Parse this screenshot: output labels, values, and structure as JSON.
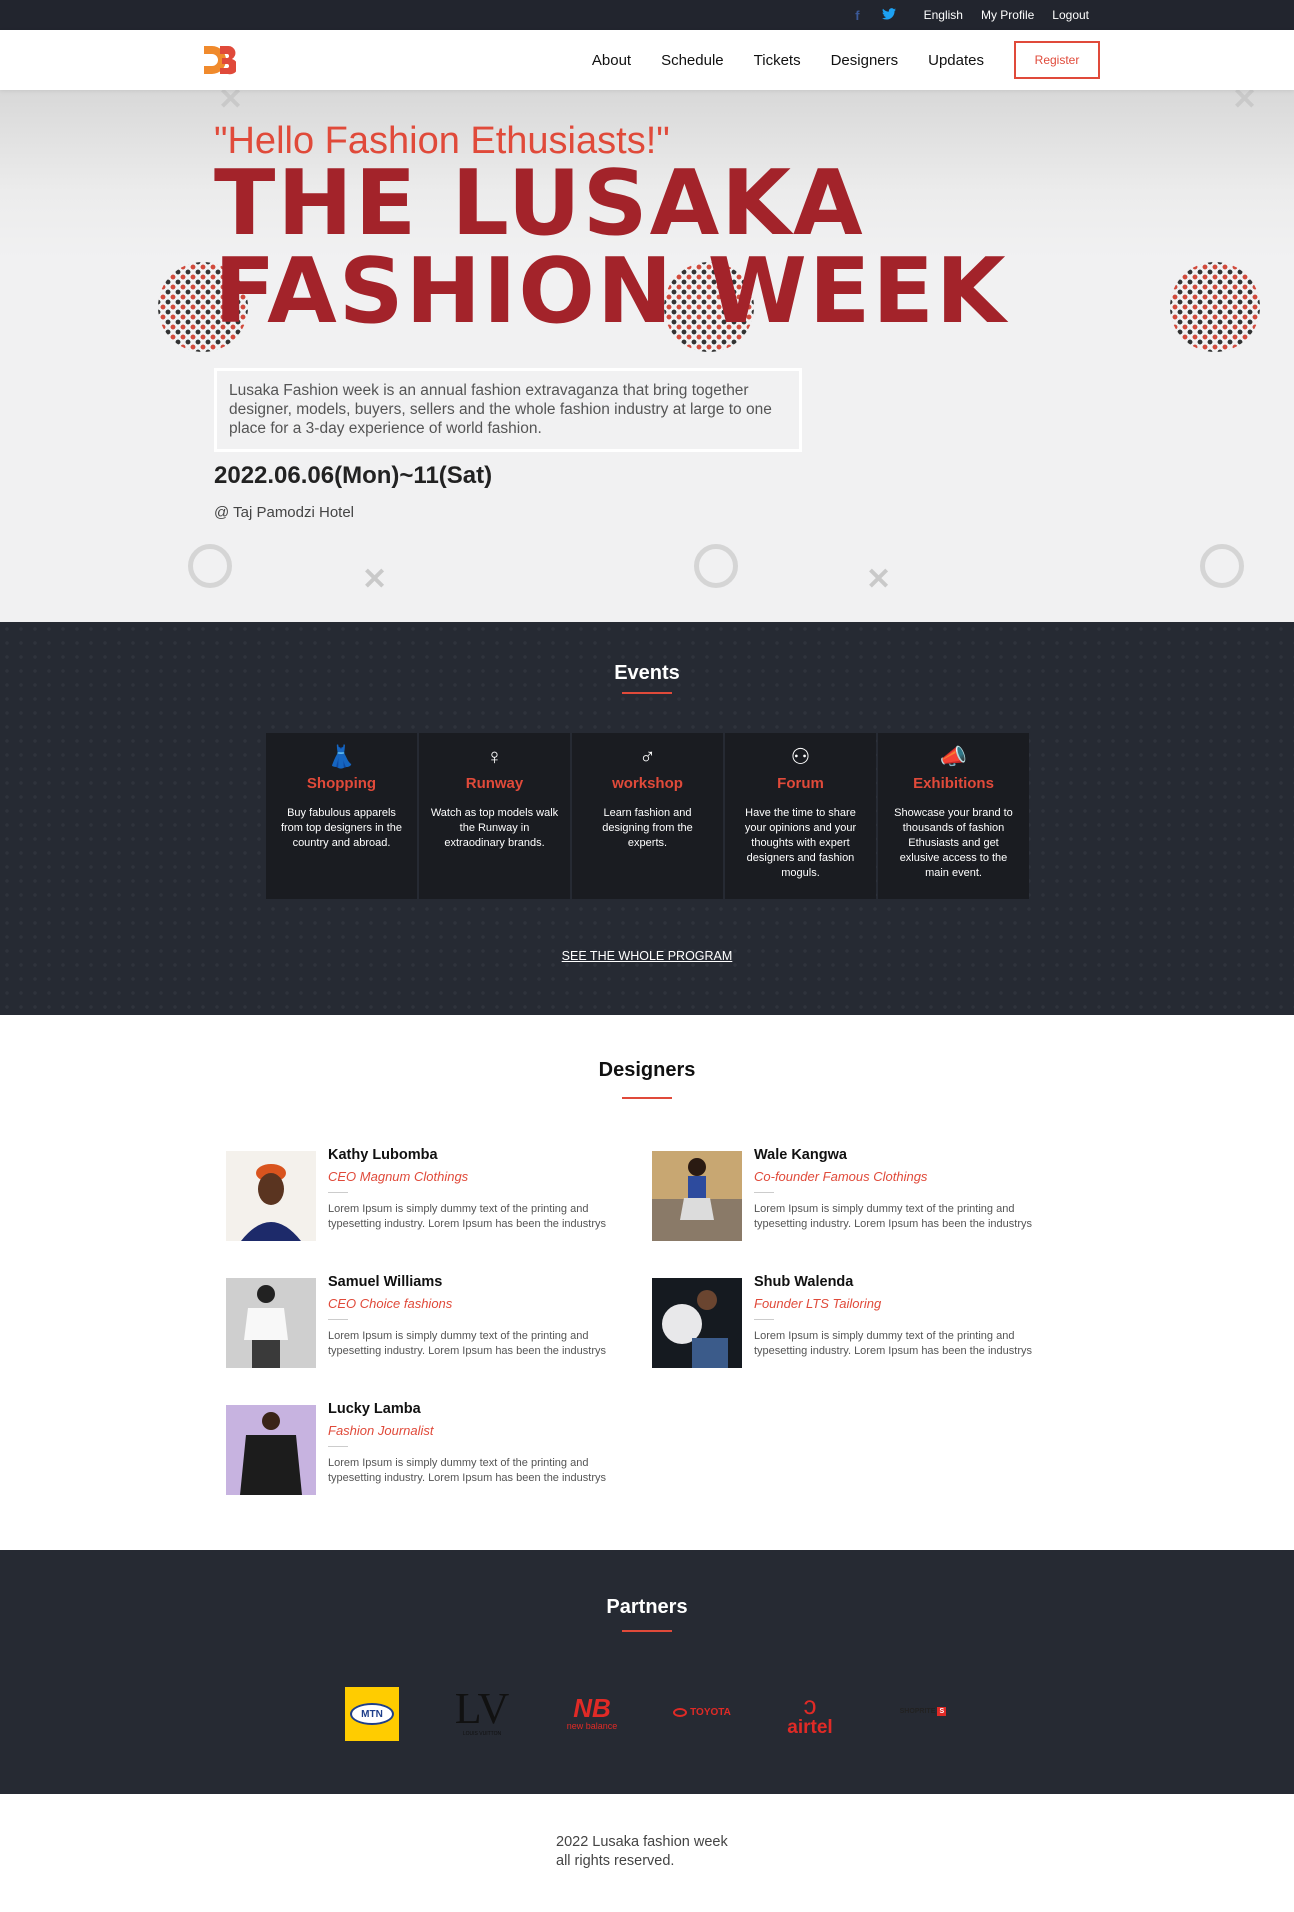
{
  "topbar": {
    "facebook": "f",
    "twitter": "t",
    "language": "English",
    "profile": "My Profile",
    "logout": "Logout"
  },
  "nav": {
    "items": [
      "About",
      "Schedule",
      "Tickets",
      "Designers",
      "Updates"
    ],
    "register": "Register"
  },
  "hero": {
    "greeting": "\"Hello Fashion Ethusiasts!\"",
    "title_line1": "THE LUSAKA",
    "title_line2": "FASHION WEEK",
    "description": "Lusaka Fashion week is an annual fashion extravaganza that bring together designer, models, buyers, sellers and the whole fashion industry at large to one place for a 3-day experience of world fashion.",
    "dates": "2022.06.06(Mon)~11(Sat)",
    "venue": "@ Taj Pamodzi Hotel"
  },
  "events": {
    "title": "Events",
    "items": [
      {
        "icon": "dress-icon",
        "title": "Shopping",
        "desc": "Buy fabulous apparels from top designers in the country and abroad."
      },
      {
        "icon": "model-icon",
        "title": "Runway",
        "desc": "Watch as top models walk the Runway in extraodinary brands."
      },
      {
        "icon": "presenter-icon",
        "title": "workshop",
        "desc": "Learn fashion and designing from the experts."
      },
      {
        "icon": "group-icon",
        "title": "Forum",
        "desc": "Have the time to share your opinions and your thoughts with expert designers and fashion moguls."
      },
      {
        "icon": "megaphone-icon",
        "title": "Exhibitions",
        "desc": "Showcase your brand to thousands of fashion Ethusiasts and get exlusive access to the main event."
      }
    ],
    "program_link": "SEE THE WHOLE PROGRAM"
  },
  "designers": {
    "title": "Designers",
    "items": [
      {
        "name": "Kathy Lubomba",
        "role": "CEO Magnum Clothings",
        "text": "Lorem Ipsum is simply dummy text of the printing and typesetting industry. Lorem Ipsum has been the industrys"
      },
      {
        "name": "Wale Kangwa",
        "role": "Co-founder Famous Clothings",
        "text": "Lorem Ipsum is simply dummy text of the printing and typesetting industry. Lorem Ipsum has been the industrys"
      },
      {
        "name": "Samuel Williams",
        "role": "CEO Choice fashions",
        "text": "Lorem Ipsum is simply dummy text of the printing and typesetting industry. Lorem Ipsum has been the industrys"
      },
      {
        "name": "Shub Walenda",
        "role": "Founder LTS Tailoring",
        "text": "Lorem Ipsum is simply dummy text of the printing and typesetting industry. Lorem Ipsum has been the industrys"
      },
      {
        "name": "Lucky Lamba",
        "role": "Fashion Journalist",
        "text": "Lorem Ipsum is simply dummy text of the printing and typesetting industry. Lorem Ipsum has been the industrys"
      }
    ]
  },
  "partners": {
    "title": "Partners",
    "mtn": "MTN",
    "lv": "LV",
    "lv_sub": "LOUIS VUITTON",
    "nb": "new balance",
    "toyota": "TOYOTA",
    "airtel": "airtel",
    "shoprite": "SHOPRITE"
  },
  "footer": {
    "line1": "2022 Lusaka fashion week",
    "line2": "all rights reserved."
  },
  "colors": {
    "accent": "#e04a3a",
    "title_red": "#a3232a",
    "dark_bg": "#262a33"
  }
}
